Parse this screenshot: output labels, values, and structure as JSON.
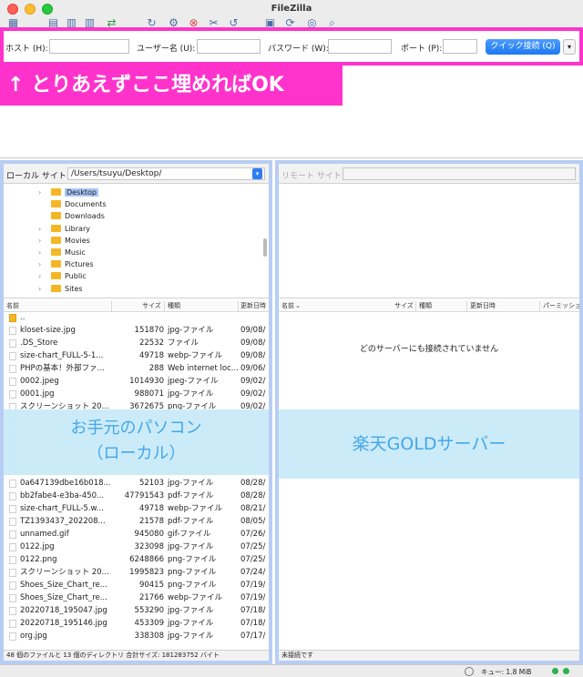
{
  "window": {
    "title": "FileZilla"
  },
  "quickconnect": {
    "host_label": "ホスト (H):",
    "user_label": "ユーザー名 (U):",
    "password_label": "パスワード (W):",
    "port_label": "ポート (P):",
    "button_label": "クイック接続 (Q)",
    "dropdown_glyph": "▾"
  },
  "annotations": {
    "banner": "↑ とりあえずここ埋めればOK",
    "local_line1": "お手元のパソコン",
    "local_line2": "（ローカル）",
    "remote": "楽天GOLDサーバー"
  },
  "local": {
    "site_label": "ローカル サイト:",
    "path": "/Users/tsuyu/Desktop/",
    "tree": [
      {
        "label": "Desktop",
        "expandable": true,
        "selected": true
      },
      {
        "label": "Documents",
        "expandable": false,
        "selected": false
      },
      {
        "label": "Downloads",
        "expandable": false,
        "selected": false
      },
      {
        "label": "Library",
        "expandable": true,
        "selected": false
      },
      {
        "label": "Movies",
        "expandable": true,
        "selected": false
      },
      {
        "label": "Music",
        "expandable": true,
        "selected": false
      },
      {
        "label": "Pictures",
        "expandable": true,
        "selected": false
      },
      {
        "label": "Public",
        "expandable": true,
        "selected": false
      },
      {
        "label": "Sites",
        "expandable": true,
        "selected": false
      }
    ],
    "columns": {
      "name": "名前",
      "size": "サイズ",
      "type": "種類",
      "date": "更新日時"
    },
    "files": [
      {
        "name": "..",
        "size": "",
        "type": "",
        "date": "",
        "folder": true
      },
      {
        "name": "kloset-size.jpg",
        "size": "151870",
        "type": "jpg-ファイル",
        "date": "09/08/",
        "folder": false
      },
      {
        "name": ".DS_Store",
        "size": "22532",
        "type": "ファイル",
        "date": "09/08/",
        "folder": false
      },
      {
        "name": "size-chart_FULL-5-1...",
        "size": "49718",
        "type": "webp-ファイル",
        "date": "09/08/",
        "folder": false
      },
      {
        "name": "PHPの基本！外部ファ...",
        "size": "288",
        "type": "Web internet loc...",
        "date": "09/06/",
        "folder": false
      },
      {
        "name": "0002.jpeg",
        "size": "1014930",
        "type": "jpeg-ファイル",
        "date": "09/02/",
        "folder": false
      },
      {
        "name": "0001.jpg",
        "size": "988071",
        "type": "jpg-ファイル",
        "date": "09/02/",
        "folder": false
      },
      {
        "name": "スクリーンショット 20...",
        "size": "3672675",
        "type": "png-ファイル",
        "date": "09/02/",
        "folder": false
      },
      {
        "name": "",
        "size": "",
        "type": "",
        "date": "",
        "folder": false
      },
      {
        "name": "",
        "size": "",
        "type": "",
        "date": "",
        "folder": false
      },
      {
        "name": "",
        "size": "",
        "type": "",
        "date": "",
        "folder": false
      },
      {
        "name": "",
        "size": "",
        "type": "",
        "date": "",
        "folder": false
      },
      {
        "name": "",
        "size": "",
        "type": "",
        "date": "",
        "folder": false
      },
      {
        "name": "0a647139dbe16b018...",
        "size": "52103",
        "type": "jpg-ファイル",
        "date": "08/28/",
        "folder": false
      },
      {
        "name": "bb2fabe4-e3ba-450...",
        "size": "47791543",
        "type": "pdf-ファイル",
        "date": "08/28/",
        "folder": false
      },
      {
        "name": "size-chart_FULL-5.w...",
        "size": "49718",
        "type": "webp-ファイル",
        "date": "08/21/",
        "folder": false
      },
      {
        "name": "TZ1393437_202208...",
        "size": "21578",
        "type": "pdf-ファイル",
        "date": "08/05/",
        "folder": false
      },
      {
        "name": "unnamed.gif",
        "size": "945080",
        "type": "gif-ファイル",
        "date": "07/26/",
        "folder": false
      },
      {
        "name": "0122.jpg",
        "size": "323098",
        "type": "jpg-ファイル",
        "date": "07/25/",
        "folder": false
      },
      {
        "name": "0122.png",
        "size": "6248866",
        "type": "png-ファイル",
        "date": "07/25/",
        "folder": false
      },
      {
        "name": "スクリーンショット 20...",
        "size": "1995823",
        "type": "png-ファイル",
        "date": "07/24/",
        "folder": false
      },
      {
        "name": "Shoes_Size_Chart_re...",
        "size": "90415",
        "type": "png-ファイル",
        "date": "07/19/",
        "folder": false
      },
      {
        "name": "Shoes_Size_Chart_re...",
        "size": "21766",
        "type": "webp-ファイル",
        "date": "07/19/",
        "folder": false
      },
      {
        "name": "20220718_195047.jpg",
        "size": "553290",
        "type": "jpg-ファイル",
        "date": "07/18/",
        "folder": false
      },
      {
        "name": "20220718_195146.jpg",
        "size": "453309",
        "type": "jpg-ファイル",
        "date": "07/18/",
        "folder": false
      },
      {
        "name": "org.jpg",
        "size": "338308",
        "type": "jpg-ファイル",
        "date": "07/17/",
        "folder": false
      }
    ],
    "status": "48 個のファイルと 13 個のディレクトリ 合計サイズ: 181283752 バイト"
  },
  "remote": {
    "site_label": "リモート サイト:",
    "columns": {
      "name": "名前",
      "size": "サイズ",
      "type": "種類",
      "date": "更新日時",
      "perm": "パーミッショ"
    },
    "empty_message": "どのサーバーにも接続されていません",
    "status": "未接続です"
  },
  "bottom": {
    "queue": "キュー: 1.8 MiB"
  }
}
